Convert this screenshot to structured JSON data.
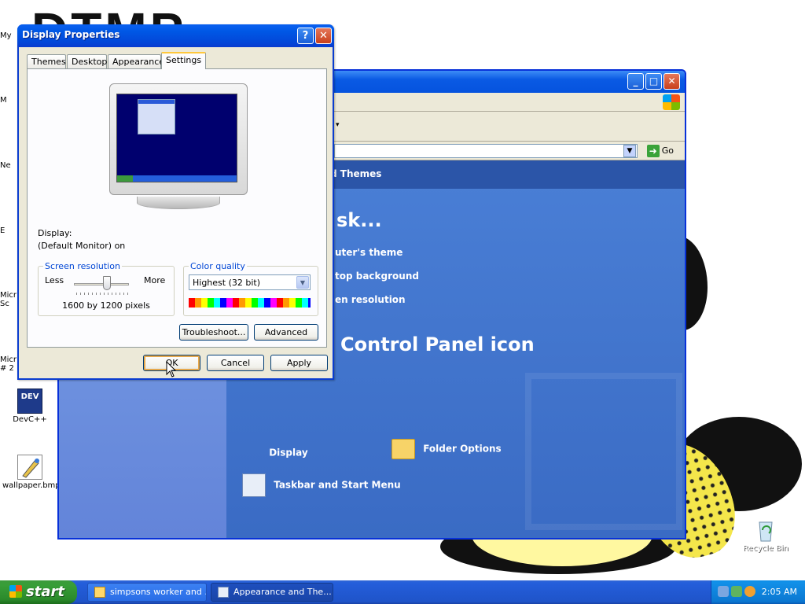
{
  "desktop": {
    "icons": [
      {
        "label": "DevC++"
      },
      {
        "label": "wallpaper.bmp"
      },
      {
        "label": "Recycle Bin"
      }
    ],
    "clipped_labels": [
      "My",
      "M",
      "Ne",
      "E",
      "Micr Sc",
      "Micr # 2"
    ]
  },
  "control_panel": {
    "header": "d Themes",
    "task_heading": "sk...",
    "tasks": [
      "uter's theme",
      "top background",
      "en resolution"
    ],
    "pick_heading": "Control Panel icon",
    "icons": [
      "Display",
      "Folder Options",
      "Taskbar and Start Menu"
    ],
    "address_go": "Go"
  },
  "dialog": {
    "title": "Display Properties",
    "help_glyph": "?",
    "close_glyph": "✕",
    "tabs": [
      "Themes",
      "Desktop",
      "Appearance",
      "Settings"
    ],
    "active_tab": "Settings",
    "display_label": "Display:",
    "display_value": "(Default Monitor) on",
    "screen_resolution": {
      "group_title": "Screen resolution",
      "less_label": "Less",
      "more_label": "More",
      "value": "1600 by 1200 pixels"
    },
    "color_quality": {
      "group_title": "Color quality",
      "selected": "Highest (32 bit)"
    },
    "buttons": {
      "troubleshoot": "Troubleshoot...",
      "advanced": "Advanced",
      "ok": "OK",
      "cancel": "Cancel",
      "apply": "Apply"
    }
  },
  "taskbar": {
    "start_label": "start",
    "tasks": [
      "simpsons worker and ...",
      "Appearance and The..."
    ],
    "clock": "2:05 AM"
  }
}
